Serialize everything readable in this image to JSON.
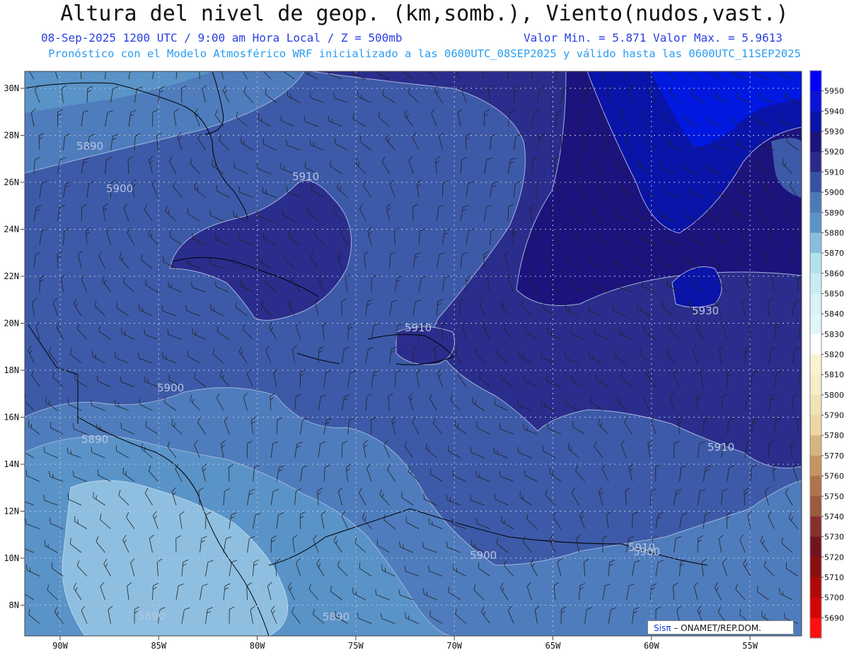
{
  "header": {
    "title": "Altura del nivel de geop. (km,somb.), Viento(nudos,vast.)",
    "subtitle_left": "08-Sep-2025  1200 UTC / 9:00 am Hora Local / Z = 500mb",
    "subtitle_right": "Valor Min. = 5.871  Valor Max. = 5.9613",
    "subtitle2": "Pronóstico con el Modelo Atmosférico WRF inicializado a las 0600UTC_08SEP2025 y válido hasta las  0600UTC_11SEP2025"
  },
  "footer": {
    "brand": "Sisπ",
    "text": "– ONAMET/REP.DOM."
  },
  "axes": {
    "lat_ticks": [
      "30N",
      "28N",
      "26N",
      "24N",
      "22N",
      "20N",
      "18N",
      "16N",
      "14N",
      "12N",
      "10N",
      "8N"
    ],
    "lon_ticks": [
      "90W",
      "85W",
      "80W",
      "75W",
      "70W",
      "65W",
      "60W",
      "55W"
    ],
    "grid": true
  },
  "legend": {
    "position": "right",
    "levels": [
      "5950",
      "5940",
      "5930",
      "5920",
      "5910",
      "5900",
      "5890",
      "5880",
      "5870",
      "5860",
      "5850",
      "5840",
      "5830",
      "5820",
      "5810",
      "5800",
      "5790",
      "5780",
      "5770",
      "5760",
      "5750",
      "5740",
      "5730",
      "5720",
      "5710",
      "5700",
      "5690"
    ],
    "colors": [
      "#0000ff",
      "#0a14d8",
      "#0a14a8",
      "#1c137d",
      "#2a2a8c",
      "#3652a8",
      "#4c7ab8",
      "#5a93c8",
      "#88bfe0",
      "#b3e2ef",
      "#c8ecf4",
      "#d8f2f8",
      "#e0f6fb",
      "#ffffff",
      "#fbf3d0",
      "#f7ecc6",
      "#f1e3b5",
      "#ecd6a2",
      "#d6b57f",
      "#c69460",
      "#b0734c",
      "#9c5a3e",
      "#872f2e",
      "#72141e",
      "#8c0f0f",
      "#b00808",
      "#d40404",
      "#ff0f0f"
    ]
  },
  "contour_labels": [
    "5890",
    "5900",
    "5910",
    "5910",
    "5930",
    "5910",
    "5900",
    "5890",
    "5910",
    "5900",
    "5900",
    "5890",
    "5890"
  ]
}
